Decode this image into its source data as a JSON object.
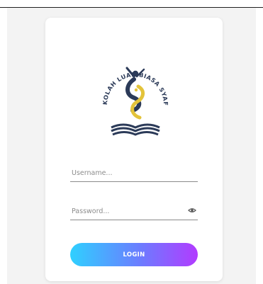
{
  "login_form": {
    "logo_text": "SEKOLAH LUAR BIASA SYAFIQ",
    "username_placeholder": "Username...",
    "password_placeholder": "Password...",
    "login_label": "LOGIN",
    "password_toggle_icon": "eye-icon"
  },
  "colors": {
    "page_background": "#f3f3f3",
    "card_background": "#ffffff",
    "logo_navy": "#2b3a58",
    "logo_gold": "#e3c33a",
    "button_gradient_start": "#2fd0ff",
    "button_gradient_end": "#b23bff"
  }
}
